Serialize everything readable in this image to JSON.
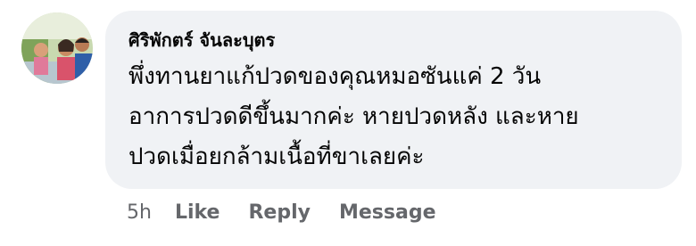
{
  "comment": {
    "author": "ศิริพักตร์ จันละบุตร",
    "lines": [
      "พึ่งทานยาแก้ปวดของคุณหมอซันแค่  2 วัน",
      "อาการปวดดีขึ้นมากค่ะ  หายปวดหลัง  และหาย",
      "ปวดเมื่อยกล้ามเนื้อที่ขาเลยค่ะ"
    ]
  },
  "actions": {
    "time": "5h",
    "like": "Like",
    "reply": "Reply",
    "message": "Message"
  },
  "colors": {
    "bubble": "#f0f2f5",
    "text": "#050505",
    "secondary": "#65676b"
  }
}
